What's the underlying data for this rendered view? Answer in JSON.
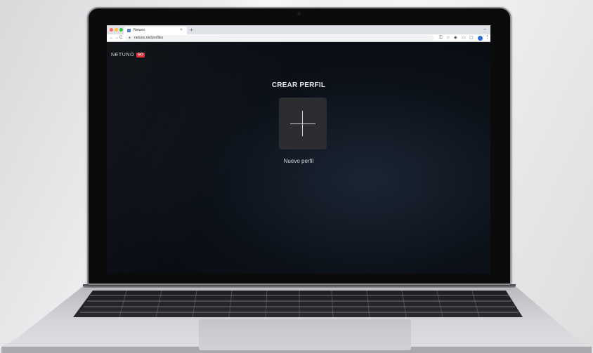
{
  "browser": {
    "tab_title": "Netuno",
    "tab_close": "×",
    "new_tab": "+",
    "minimize": "–",
    "nav": {
      "back": "←",
      "forward": "→",
      "reload": "C"
    },
    "url": "netuno.net/profiles",
    "toolbar_icons": [
      "key-icon",
      "star-icon",
      "extension-icon",
      "cast-icon",
      "profile-icon",
      "menu-icon"
    ],
    "menu_dots": "⋮"
  },
  "app": {
    "logo_text": "NETUNO",
    "logo_badge": "GO",
    "brand_color": "#d3262e"
  },
  "page": {
    "title": "CREAR PERFIL",
    "add_profile_icon": "plus-icon",
    "new_profile_label": "Nuevo perfil"
  }
}
